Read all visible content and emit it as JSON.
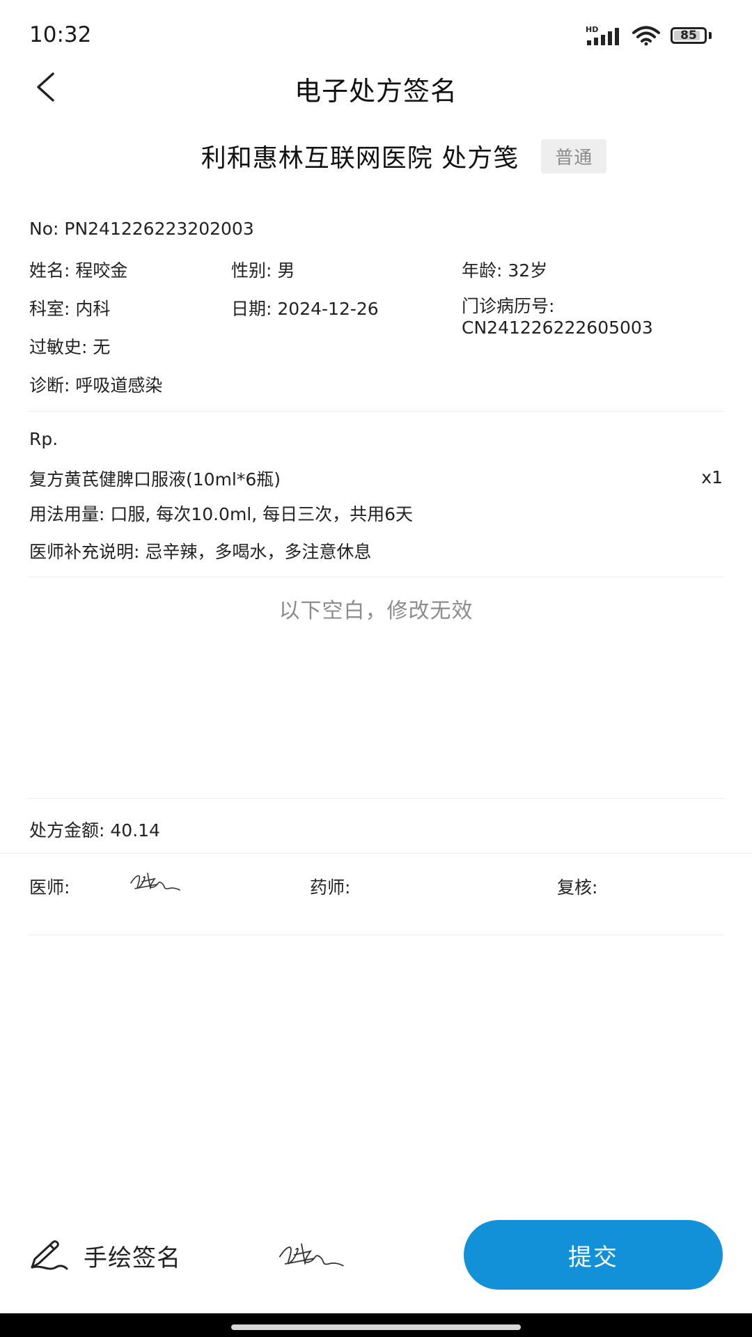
{
  "status": {
    "time": "10:32",
    "network": "HD",
    "battery": "85"
  },
  "header": {
    "title": "电子处方签名"
  },
  "prescription": {
    "hospital": "利和惠林互联网医院 处方笺",
    "type_badge": "普通",
    "no_label": "No:",
    "no_value": "PN241226223202003",
    "name_label": "姓名:",
    "name_value": "程咬金",
    "gender_label": "性别:",
    "gender_value": "男",
    "age_label": "年龄:",
    "age_value": "32岁",
    "dept_label": "科室:",
    "dept_value": "内科",
    "date_label": "日期:",
    "date_value": "2024-12-26",
    "record_label": "门诊病历号:",
    "record_value": "CN241226222605003",
    "allergy_label": "过敏史:",
    "allergy_value": "无",
    "diagnosis_label": "诊断:",
    "diagnosis_value": "呼吸道感染",
    "rp_label": "Rp.",
    "drug_name": "复方黄芪健脾口服液(10ml*6瓶)",
    "drug_qty": "x1",
    "usage_label": "用法用量:",
    "usage_value": "口服, 每次10.0ml, 每日三次，共用6天",
    "note_label": "医师补充说明:",
    "note_value": "忌辛辣，多喝水，多注意休息",
    "blank_note": "以下空白，修改无效",
    "amount_label": "处方金额:",
    "amount_value": "40.14",
    "doctor_label": "医师:",
    "pharmacist_label": "药师:",
    "reviewer_label": "复核:"
  },
  "footer": {
    "draw_label": "手绘签名",
    "submit_label": "提交"
  }
}
